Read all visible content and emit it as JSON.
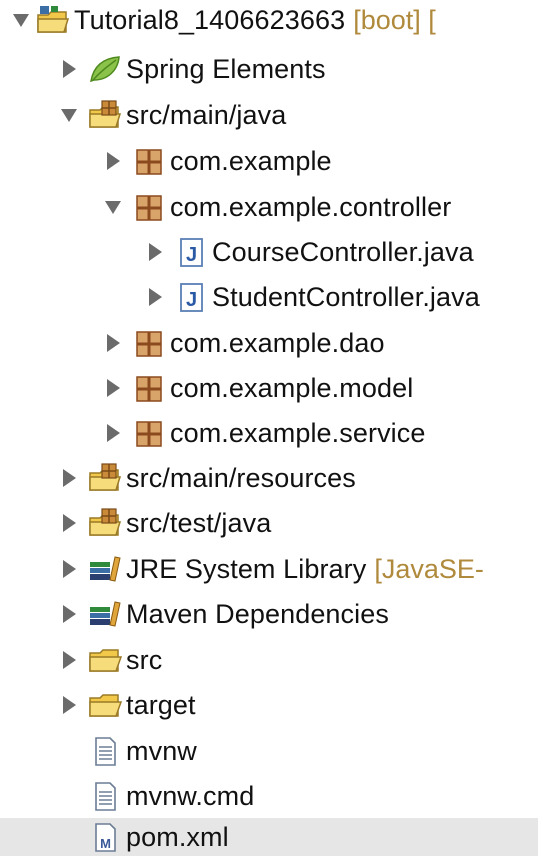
{
  "tree": {
    "root": {
      "label": "Tutorial8_1406623663",
      "decoration": "[boot] ["
    },
    "spring_elements": {
      "label": "Spring Elements"
    },
    "src_main_java": {
      "label": "src/main/java"
    },
    "pkg_example": {
      "label": "com.example"
    },
    "pkg_controller": {
      "label": "com.example.controller"
    },
    "course_controller": {
      "label": "CourseController.java"
    },
    "student_controller": {
      "label": "StudentController.java"
    },
    "pkg_dao": {
      "label": "com.example.dao"
    },
    "pkg_model": {
      "label": "com.example.model"
    },
    "pkg_service": {
      "label": "com.example.service"
    },
    "src_main_resources": {
      "label": "src/main/resources"
    },
    "src_test_java": {
      "label": "src/test/java"
    },
    "jre_library": {
      "label": "JRE System Library",
      "decoration": "[JavaSE-"
    },
    "maven_deps": {
      "label": "Maven Dependencies"
    },
    "folder_src": {
      "label": "src"
    },
    "folder_target": {
      "label": "target"
    },
    "file_mvnw": {
      "label": "mvnw"
    },
    "file_mvnw_cmd": {
      "label": "mvnw.cmd"
    },
    "file_pom": {
      "label": "pom.xml"
    }
  },
  "colors": {
    "decoration": "#b08a3c",
    "selection": "#e6e6e6",
    "folder": "#f2c84b",
    "package": "#a0522d",
    "java_file": "#3a6ea5",
    "spring": "#6db33f"
  }
}
